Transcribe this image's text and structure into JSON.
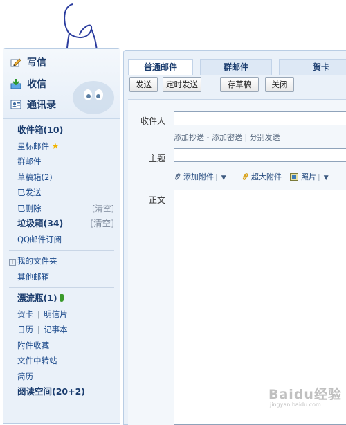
{
  "sidebar": {
    "write_label": "写信",
    "inbox_label": "收信",
    "contacts_label": "通讯录",
    "folders": [
      {
        "label": "收件箱(10)"
      },
      {
        "label": "星标邮件"
      },
      {
        "label": "群邮件"
      },
      {
        "label": "草稿箱(2)"
      },
      {
        "label": "已发送"
      },
      {
        "label": "已删除",
        "clear": "[清空]"
      },
      {
        "label": "垃圾箱(34)",
        "clear": "[清空]"
      },
      {
        "label": "QQ邮件订阅"
      }
    ],
    "my_folders": "我的文件夹",
    "other_mailboxes": "其他邮箱",
    "apps": {
      "drift_bottle": "漂流瓶(1)",
      "cards": "贺卡",
      "postcards": "明信片",
      "calendar": "日历",
      "notes": "记事本",
      "attachment_collection": "附件收藏",
      "file_transfer": "文件中转站",
      "resume": "简历",
      "reading_space": "阅读空间(20+2)"
    }
  },
  "main": {
    "tabs": [
      "普通邮件",
      "群邮件",
      "贺卡"
    ],
    "toolbar": {
      "send": "发送",
      "scheduled_send": "定时发送",
      "save_draft": "存草稿",
      "close": "关闭"
    },
    "form": {
      "to_label": "收件人",
      "to_value": "",
      "cc_links": {
        "add_cc": "添加抄送",
        "dash": " - ",
        "add_bcc": "添加密送",
        "sep": " | ",
        "separate_send": "分别发送"
      },
      "subject_label": "主题",
      "subject_value": "",
      "attach": {
        "add_attachment": "添加附件",
        "super_attachment": "超大附件",
        "photo": "照片"
      },
      "body_label": "正文"
    }
  },
  "watermark": {
    "main": "Baidu经验",
    "sub": "jingyan.baidu.com"
  },
  "colors": {
    "panel_bg": "#eaf1f9",
    "panel_border": "#b9cde4",
    "link_blue": "#1d4b8c",
    "annotation_ink": "#2a3c9e"
  }
}
